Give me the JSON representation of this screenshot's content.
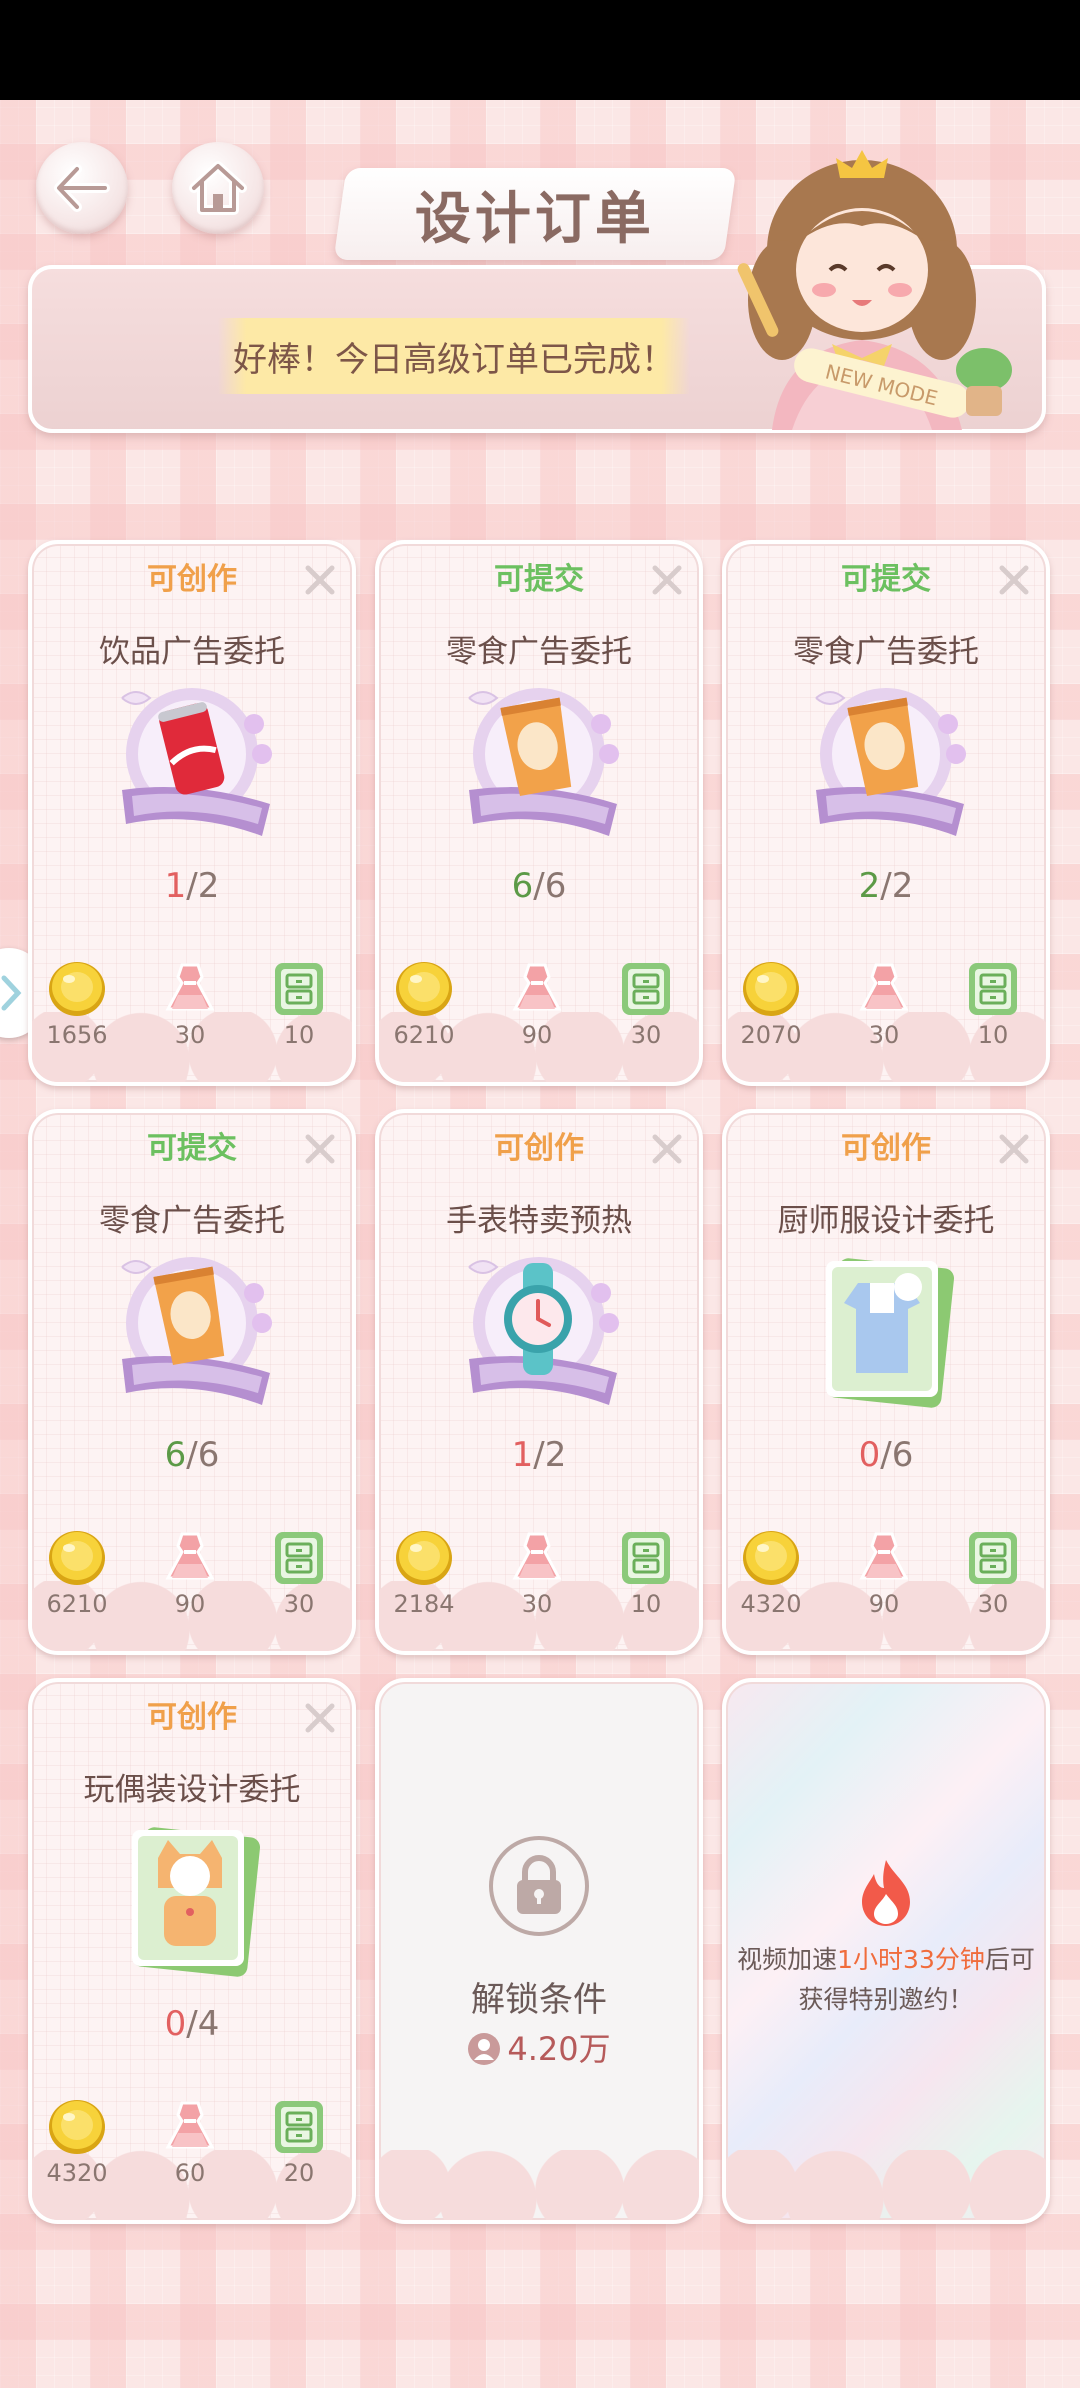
{
  "header": {
    "title": "设计订单",
    "notice": "好棒！今日高级订单已完成！",
    "mascot_badge": "NEW MODE"
  },
  "cards": [
    {
      "status": "可创作",
      "title": "饮品广告委托",
      "current": "1",
      "total": "2",
      "gold": "1656",
      "dress": "30",
      "cabinet": "10"
    },
    {
      "status": "可提交",
      "title": "零食广告委托",
      "current": "6",
      "total": "6",
      "gold": "6210",
      "dress": "90",
      "cabinet": "30"
    },
    {
      "status": "可提交",
      "title": "零食广告委托",
      "current": "2",
      "total": "2",
      "gold": "2070",
      "dress": "30",
      "cabinet": "10"
    },
    {
      "status": "可提交",
      "title": "零食广告委托",
      "current": "6",
      "total": "6",
      "gold": "6210",
      "dress": "90",
      "cabinet": "30"
    },
    {
      "status": "可创作",
      "title": "手表特卖预热",
      "current": "1",
      "total": "2",
      "gold": "2184",
      "dress": "30",
      "cabinet": "10"
    },
    {
      "status": "可创作",
      "title": "厨师服设计委托",
      "current": "0",
      "total": "6",
      "gold": "4320",
      "dress": "90",
      "cabinet": "30"
    },
    {
      "status": "可创作",
      "title": "玩偶装设计委托",
      "current": "0",
      "total": "4",
      "gold": "4320",
      "dress": "60",
      "cabinet": "20"
    }
  ],
  "locked": {
    "label": "解锁条件",
    "requirement": "4.20万"
  },
  "video": {
    "prefix": "视频加速",
    "time": "1小时33分钟",
    "suffix_line1": "后可",
    "line2": "获得特别邀约！"
  }
}
